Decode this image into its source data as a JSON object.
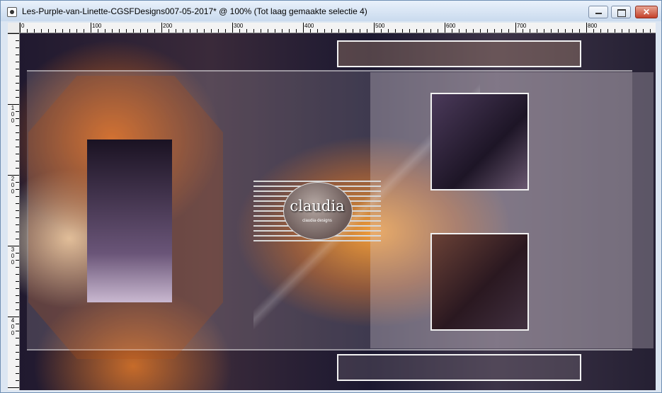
{
  "window": {
    "title": "Les-Purple-van-Linette-CGSFDesigns007-05-2017* @ 100% (Tot laag gemaakte selectie 4)",
    "minimize_glyph": "",
    "maximize_glyph": "",
    "close_glyph": "✕"
  },
  "rulers": {
    "horizontal_labels": [
      "0",
      "100",
      "200",
      "300",
      "400",
      "500",
      "600",
      "700",
      "800"
    ],
    "vertical_labels": [
      [
        "1",
        "0",
        "0"
      ],
      [
        "2",
        "0",
        "0"
      ],
      [
        "3",
        "0",
        "0"
      ],
      [
        "4",
        "0",
        "0"
      ]
    ]
  },
  "canvas": {
    "watermark_text": "claudia",
    "watermark_subtext": "claudia·designs",
    "colors": {
      "orange_glow": "#f39014",
      "deep_purple": "#1b1830",
      "frame_white": "#f2f2f2"
    }
  }
}
